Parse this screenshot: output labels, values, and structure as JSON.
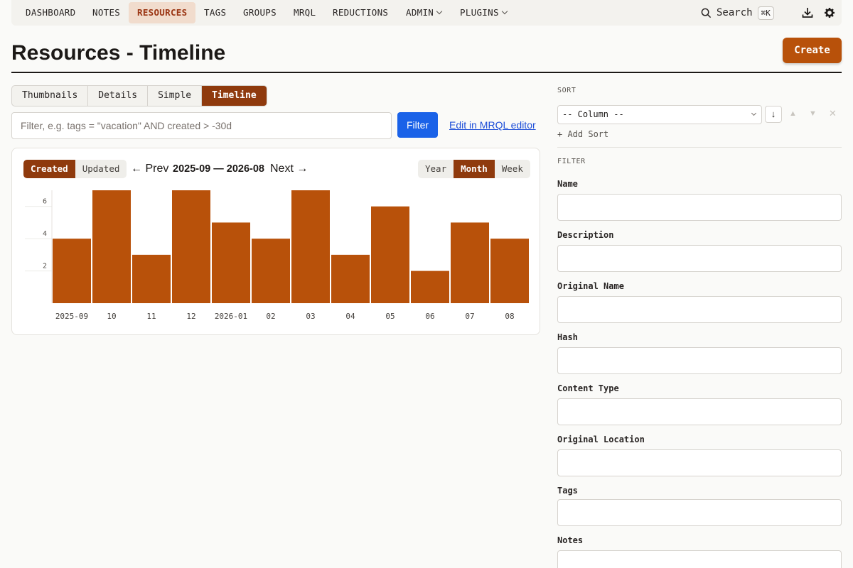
{
  "nav": {
    "items": [
      "DASHBOARD",
      "NOTES",
      "RESOURCES",
      "TAGS",
      "GROUPS",
      "MRQL",
      "REDUCTIONS",
      "ADMIN",
      "PLUGINS"
    ],
    "active": "RESOURCES",
    "search_label": "Search",
    "search_shortcut": "⌘K"
  },
  "header": {
    "title": "Resources - Timeline",
    "create_label": "Create"
  },
  "view_tabs": [
    "Thumbnails",
    "Details",
    "Simple",
    "Timeline"
  ],
  "active_view": "Timeline",
  "filter": {
    "placeholder": "Filter, e.g. tags = \"vacation\" AND created > -30d",
    "button_label": "Filter",
    "mrql_link": "Edit in MRQL editor"
  },
  "timeline": {
    "mode_options": [
      "Created",
      "Updated"
    ],
    "active_mode": "Created",
    "prev_label": "← Prev",
    "next_label": "Next →",
    "range_label": "2025-09 — 2026-08",
    "granularity_options": [
      "Year",
      "Month",
      "Week"
    ],
    "active_granularity": "Month"
  },
  "chart_data": {
    "type": "bar",
    "categories": [
      "2025-09",
      "10",
      "11",
      "12",
      "2026-01",
      "02",
      "03",
      "04",
      "05",
      "06",
      "07",
      "08"
    ],
    "values": [
      4,
      7,
      3,
      7,
      5,
      4,
      7,
      3,
      6,
      2,
      5,
      4
    ],
    "ylim": [
      0,
      7
    ],
    "yticks": [
      2,
      4,
      6
    ],
    "grid": true,
    "color": "#b8510a"
  },
  "sort": {
    "section_label": "SORT",
    "column_placeholder": "-- Column --",
    "direction_symbol": "↓",
    "add_label": "+ Add Sort"
  },
  "filter_panel": {
    "section_label": "FILTER",
    "fields": [
      "Name",
      "Description",
      "Original Name",
      "Hash",
      "Content Type",
      "Original Location",
      "Tags",
      "Notes"
    ]
  }
}
